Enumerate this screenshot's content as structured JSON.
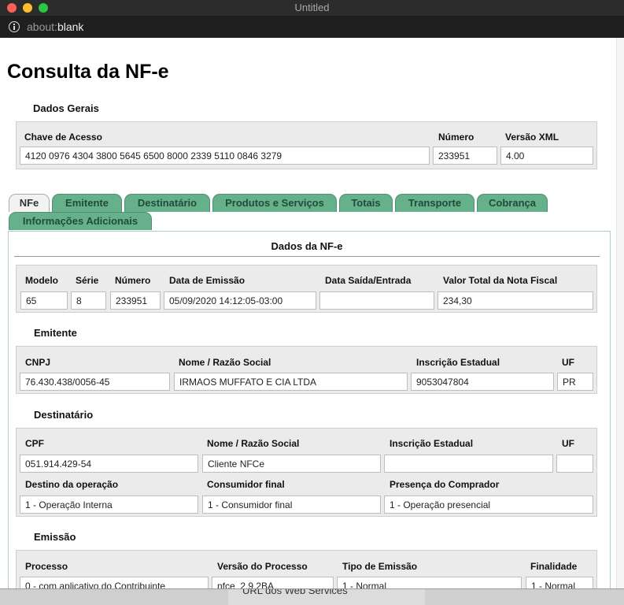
{
  "window": {
    "title": "Untitled",
    "url_prefix": "about:",
    "url_rest": "blank"
  },
  "behind_text": "URL dos Web Services",
  "page": {
    "title": "Consulta da NF-e"
  },
  "dados_gerais": {
    "heading": "Dados Gerais",
    "chave_label": "Chave de Acesso",
    "chave_value": "4120 0976 4304 3800 5645 6500 8000 2339 5110 0846 3279",
    "numero_label": "Número",
    "numero_value": "233951",
    "versao_label": "Versão XML",
    "versao_value": "4.00"
  },
  "tabs": [
    "NFe",
    "Emitente",
    "Destinatário",
    "Produtos e Serviços",
    "Totais",
    "Transporte",
    "Cobrança",
    "Informações Adicionais"
  ],
  "panel_title": "Dados da NF-e",
  "nfe": {
    "modelo_label": "Modelo",
    "modelo_value": "65",
    "serie_label": "Série",
    "serie_value": "8",
    "numero_label": "Número",
    "numero_value": "233951",
    "emissao_label": "Data de Emissão",
    "emissao_value": "05/09/2020 14:12:05-03:00",
    "saida_label": "Data Saída/Entrada",
    "saida_value": "",
    "total_label": "Valor Total da Nota Fiscal",
    "total_value": "234,30"
  },
  "emitente": {
    "heading": "Emitente",
    "cnpj_label": "CNPJ",
    "cnpj_value": "76.430.438/0056-45",
    "nome_label": "Nome / Razão Social",
    "nome_value": "IRMAOS MUFFATO E CIA LTDA",
    "ie_label": "Inscrição Estadual",
    "ie_value": "9053047804",
    "uf_label": "UF",
    "uf_value": "PR"
  },
  "destinatario": {
    "heading": "Destinatário",
    "cpf_label": "CPF",
    "cpf_value": "051.914.429-54",
    "nome_label": "Nome / Razão Social",
    "nome_value": "Cliente NFCe",
    "ie_label": "Inscrição Estadual",
    "ie_value": "",
    "uf_label": "UF",
    "uf_value": "",
    "destino_label": "Destino da operação",
    "destino_value": "1 - Operação Interna",
    "consumidor_label": "Consumidor final",
    "consumidor_value": "1 - Consumidor final",
    "presenca_label": "Presença do Comprador",
    "presenca_value": "1 - Operação presencial"
  },
  "emissao": {
    "heading": "Emissão",
    "processo_label": "Processo",
    "processo_value": "0 - com aplicativo do Contribuinte",
    "versao_label": "Versão do Processo",
    "versao_value": "nfce_2.9.2BA",
    "tipo_label": "Tipo de Emissão",
    "tipo_value": "1 - Normal",
    "finalidade_label": "Finalidade",
    "finalidade_value": "1 - Normal"
  }
}
